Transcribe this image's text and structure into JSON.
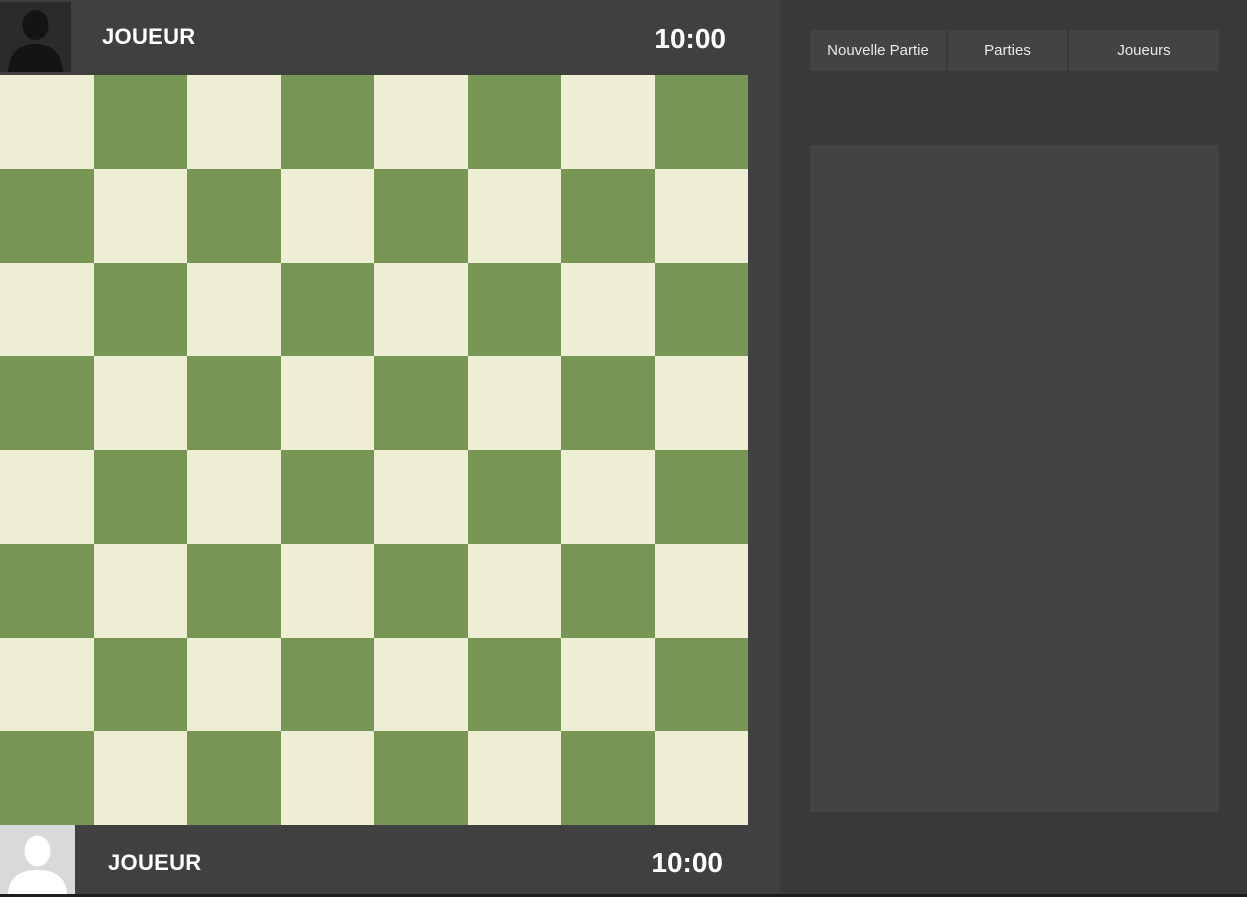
{
  "players": {
    "top": {
      "name": "JOUEUR",
      "clock": "10:00",
      "avatar_icon": "dark-user-silhouette-icon"
    },
    "bottom": {
      "name": "JOUEUR",
      "clock": "10:00",
      "avatar_icon": "light-user-silhouette-icon"
    }
  },
  "board": {
    "files": 8,
    "ranks": 8,
    "light_color": "#eeeed5",
    "dark_color": "#779654"
  },
  "menu": {
    "tabs": [
      {
        "label": "Nouvelle Partie"
      },
      {
        "label": "Parties"
      },
      {
        "label": "Joueurs"
      }
    ]
  }
}
